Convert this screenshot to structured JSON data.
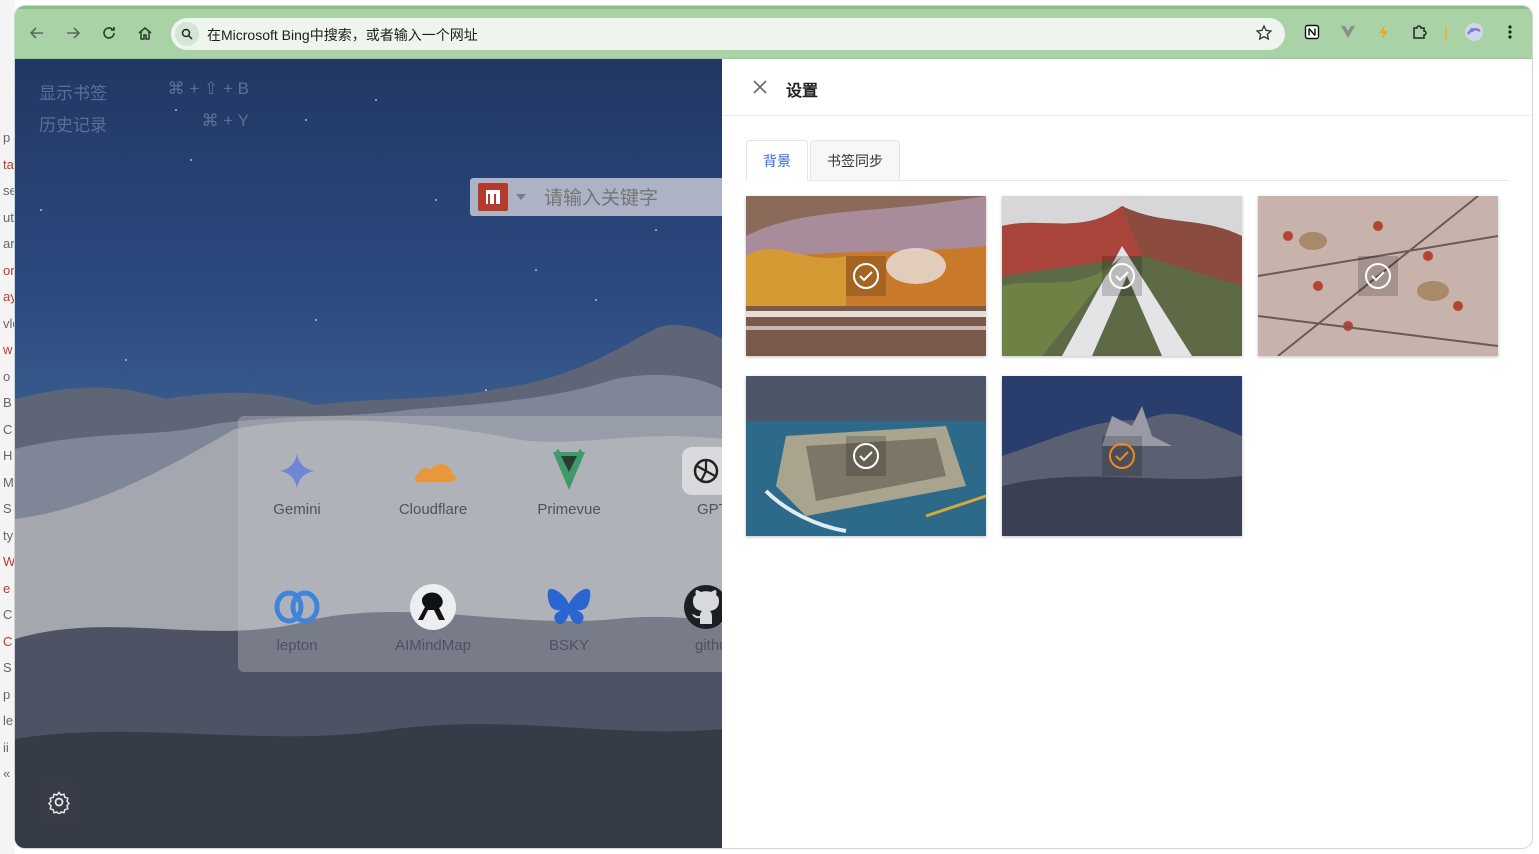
{
  "browser": {
    "omnibox_text": "在Microsoft Bing中搜索，或者输入一个网址",
    "accent_color": "#a9d3a7"
  },
  "left_strip": [
    "p",
    "ta",
    "se",
    "ut",
    "ar",
    "or",
    "ay",
    "vlo",
    "w",
    "o",
    "B",
    "C",
    "H",
    "M",
    "S",
    "ty",
    "W",
    "e",
    "C",
    "C",
    "S",
    "p",
    "le",
    "ii",
    "«"
  ],
  "shortcuts": [
    {
      "label": "显示书签",
      "keys": "⌘ + ⇧ + B"
    },
    {
      "label": "历史记录",
      "keys": "⌘ + Y"
    }
  ],
  "search": {
    "placeholder": "请输入关键字",
    "engine_icon": "maoyan-logo"
  },
  "sites": [
    {
      "label": "Gemini",
      "icon": "gemini-icon"
    },
    {
      "label": "Cloudflare",
      "icon": "cloudflare-icon"
    },
    {
      "label": "Primevue",
      "icon": "primevue-icon"
    },
    {
      "label": "GPT",
      "icon": "openai-icon"
    },
    {
      "label": "lepton",
      "icon": "lepton-icon"
    },
    {
      "label": "AIMindMap",
      "icon": "aimindmap-icon"
    },
    {
      "label": "BSKY",
      "icon": "bluesky-icon"
    },
    {
      "label": "github",
      "icon": "github-icon"
    }
  ],
  "settings": {
    "title": "设置",
    "tabs": [
      {
        "label": "背景",
        "active": true
      },
      {
        "label": "书签同步",
        "active": false
      }
    ],
    "backgrounds": [
      {
        "scene": "autumn lake with castle",
        "selected": false
      },
      {
        "scene": "rainbow mountain ridge",
        "selected": false
      },
      {
        "scene": "waxwing birds on berry branches",
        "selected": false
      },
      {
        "scene": "walled coastal city aerial",
        "selected": false
      },
      {
        "scene": "badlands rock formations at dusk",
        "selected": true
      }
    ]
  }
}
